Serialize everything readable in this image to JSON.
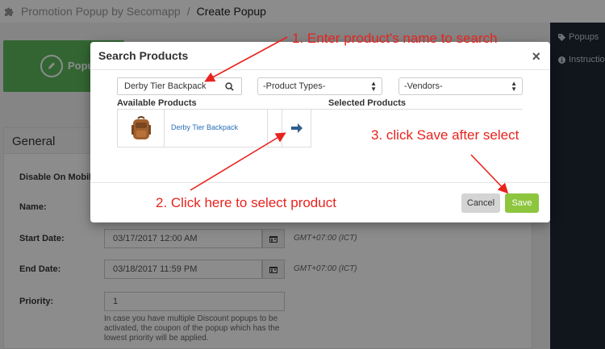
{
  "topbar": {
    "app_title": "Promotion Popup by Secomapp",
    "separator": "/",
    "page_title": "Create Popup"
  },
  "background": {
    "popup_button_label": "Popup",
    "panel_title": "General",
    "labels": {
      "disable_mobile": "Disable On Mobile:",
      "name": "Name:",
      "start_date": "Start Date:",
      "end_date": "End Date:",
      "priority": "Priority:"
    },
    "start_date_value": "03/17/2017 12:00 AM",
    "end_date_value": "03/18/2017 11:59 PM",
    "timezone": "GMT+07:00 (ICT)",
    "priority_value": "1",
    "priority_help": "In case you have multiple Discount popups to be activated, the coupon of the popup which has the lowest priority will be applied."
  },
  "sidebar": {
    "items": [
      {
        "label": "Popups",
        "icon": "tag-icon"
      },
      {
        "label": "Instructio",
        "icon": "info-icon"
      }
    ]
  },
  "modal": {
    "title": "Search Products",
    "close": "×",
    "search_value": "Derby Tier Backpack",
    "product_types_placeholder": "-Product Types-",
    "vendors_placeholder": "-Vendors-",
    "available_label": "Available Products",
    "selected_label": "Selected Products",
    "products": [
      {
        "name": "Derby Tier Backpack"
      }
    ],
    "cancel_label": "Cancel",
    "save_label": "Save"
  },
  "annotations": {
    "step1": "1. Enter product's name to search",
    "step2": "2. Click here to select product",
    "step3": "3. click Save after select"
  },
  "colors": {
    "accent_green": "#5cb85c",
    "save_green": "#8dc53e",
    "annotation_red": "#e8231e",
    "sidebar_bg": "#1f2733"
  }
}
